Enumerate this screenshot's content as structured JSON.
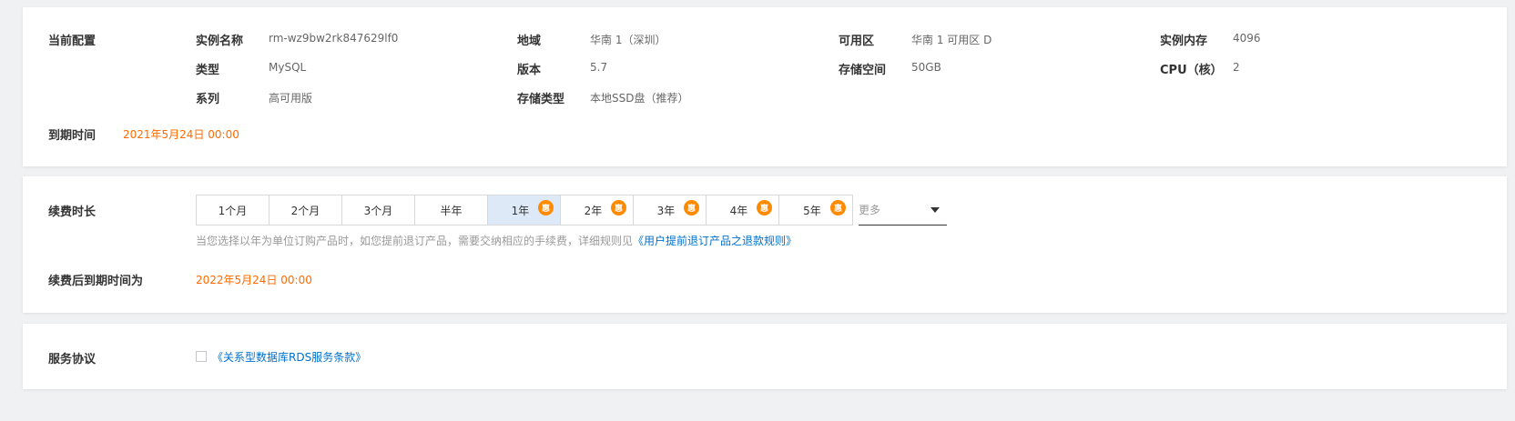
{
  "config": {
    "section_label": "当前配置",
    "expiry_label": "到期时间",
    "expiry_value": "2021年5月24日 00:00",
    "fields": {
      "instance_name_label": "实例名称",
      "instance_name_value": "rm-wz9bw2rk847629lf0",
      "type_label": "类型",
      "type_value": "MySQL",
      "series_label": "系列",
      "series_value": "高可用版",
      "region_label": "地域",
      "region_value": "华南 1（深圳）",
      "version_label": "版本",
      "version_value": "5.7",
      "storage_type_label": "存储类型",
      "storage_type_value": "本地SSD盘（推荐）",
      "zone_label": "可用区",
      "zone_value": "华南 1 可用区 D",
      "storage_label": "存储空间",
      "storage_value": "50GB",
      "memory_label": "实例内存",
      "memory_value": "4096",
      "cpu_label": "CPU（核）",
      "cpu_value": "2"
    }
  },
  "renew": {
    "duration_label": "续费时长",
    "options": [
      {
        "label": "1个月",
        "discount": ""
      },
      {
        "label": "2个月",
        "discount": ""
      },
      {
        "label": "3个月",
        "discount": ""
      },
      {
        "label": "半年",
        "discount": ""
      },
      {
        "label": "1年",
        "discount": "惠"
      },
      {
        "label": "2年",
        "discount": "惠"
      },
      {
        "label": "3年",
        "discount": "惠"
      },
      {
        "label": "4年",
        "discount": "惠"
      },
      {
        "label": "5年",
        "discount": "惠"
      }
    ],
    "selected": "1年",
    "more_placeholder": "更多",
    "hint_text": "当您选择以年为单位订购产品时，如您提前退订产品，需要交纳相应的手续费，详细规则见",
    "hint_link": "《用户提前退订产品之退款规则》",
    "new_expiry_label": "续费后到期时间为",
    "new_expiry_value": "2022年5月24日 00:00"
  },
  "agreement": {
    "label": "服务协议",
    "link": "《关系型数据库RDS服务条款》",
    "checked": false
  },
  "colors": {
    "accent_orange": "#ff6a00",
    "link_blue": "#0070cc",
    "selected_bg": "#dde9f7",
    "badge": "#ff8a00"
  }
}
